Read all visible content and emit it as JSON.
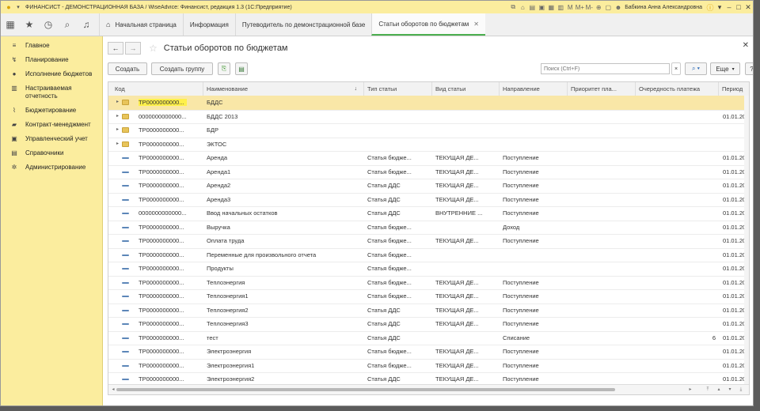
{
  "window": {
    "title": "ФИНАНСИСТ - ДЕМОНСТРАЦИОННАЯ БАЗА / WiseAdvice: Финансист, редакция 1.3  (1С:Предприятие)",
    "user": "Бабкина Анна Александровна",
    "tools": [
      "M",
      "M+",
      "M-"
    ]
  },
  "tabs": [
    {
      "label": "Начальная страница"
    },
    {
      "label": "Информация"
    },
    {
      "label": "Путеводитель по демонстрационной базе"
    },
    {
      "label": "Статьи оборотов по бюджетам"
    }
  ],
  "sidebar": {
    "items": [
      {
        "label": "Главное",
        "icon": "menu-icon"
      },
      {
        "label": "Планирование",
        "icon": "planning-icon"
      },
      {
        "label": "Исполнение бюджетов",
        "icon": "coin-icon"
      },
      {
        "label": "Настраиваемая отчетность",
        "icon": "report-icon"
      },
      {
        "label": "Бюджетирование",
        "icon": "chart-line-icon"
      },
      {
        "label": "Контракт-менеджмент",
        "icon": "contract-icon"
      },
      {
        "label": "Управленческий учет",
        "icon": "ledger-icon"
      },
      {
        "label": "Справочники",
        "icon": "book-icon"
      },
      {
        "label": "Администрирование",
        "icon": "gear-icon"
      }
    ]
  },
  "form": {
    "title": "Статьи оборотов по бюджетам",
    "buttons": {
      "create": "Создать",
      "create_group": "Создать группу",
      "more": "Еще",
      "help": "?"
    },
    "search_placeholder": "Поиск (Ctrl+F)"
  },
  "table": {
    "columns": [
      "Код",
      "Наименование",
      "Тип статьи",
      "Вид статьи",
      "Направление",
      "Приоритет пла...",
      "Очередность платежа",
      "Период"
    ],
    "rows": [
      {
        "kind": "folder",
        "code": "ТР0000000000...",
        "name": "БДДС",
        "type": "",
        "vid": "",
        "dir": "",
        "prio": "",
        "order": "",
        "period": "",
        "selected": true
      },
      {
        "kind": "folder",
        "code": "0000000000000...",
        "name": "БДДС 2013",
        "type": "",
        "vid": "",
        "dir": "",
        "prio": "",
        "order": "",
        "period": "01.01.20"
      },
      {
        "kind": "folder",
        "code": "ТР0000000000...",
        "name": "БДР",
        "type": "",
        "vid": "",
        "dir": "",
        "prio": "",
        "order": "",
        "period": ""
      },
      {
        "kind": "folder",
        "code": "ТР0000000000...",
        "name": "ЭКТОС",
        "type": "",
        "vid": "",
        "dir": "",
        "prio": "",
        "order": "",
        "period": ""
      },
      {
        "kind": "item",
        "code": "ТР0000000000...",
        "name": "Аренда",
        "type": "Статья бюдже...",
        "vid": "ТЕКУЩАЯ ДЕ...",
        "dir": "Поступление",
        "prio": "",
        "order": "",
        "period": "01.01.20"
      },
      {
        "kind": "item",
        "code": "ТР0000000000...",
        "name": "Аренда1",
        "type": "Статья бюдже...",
        "vid": "ТЕКУЩАЯ ДЕ...",
        "dir": "Поступление",
        "prio": "",
        "order": "",
        "period": "01.01.20"
      },
      {
        "kind": "item",
        "code": "ТР0000000000...",
        "name": "Аренда2",
        "type": "Статья ДДС",
        "vid": "ТЕКУЩАЯ ДЕ...",
        "dir": "Поступление",
        "prio": "",
        "order": "",
        "period": "01.01.20"
      },
      {
        "kind": "item",
        "code": "ТР0000000000...",
        "name": "Аренда3",
        "type": "Статья ДДС",
        "vid": "ТЕКУЩАЯ ДЕ...",
        "dir": "Поступление",
        "prio": "",
        "order": "",
        "period": "01.01.20"
      },
      {
        "kind": "item",
        "code": "0000000000000...",
        "name": "Ввод начальных остатков",
        "type": "Статья ДДС",
        "vid": "ВНУТРЕННИЕ ...",
        "dir": "Поступление",
        "prio": "",
        "order": "",
        "period": "01.01.20"
      },
      {
        "kind": "item",
        "code": "ТР0000000000...",
        "name": "Выручка",
        "type": "Статья бюдже...",
        "vid": "",
        "dir": "Доход",
        "prio": "",
        "order": "",
        "period": "01.01.20"
      },
      {
        "kind": "item",
        "code": "ТР0000000000...",
        "name": "Оплата труда",
        "type": "Статья бюдже...",
        "vid": "ТЕКУЩАЯ ДЕ...",
        "dir": "Поступление",
        "prio": "",
        "order": "",
        "period": "01.01.20"
      },
      {
        "kind": "item",
        "code": "ТР0000000000...",
        "name": "Переменные для произвольного отчета",
        "type": "Статья бюдже...",
        "vid": "",
        "dir": "",
        "prio": "",
        "order": "",
        "period": "01.01.20"
      },
      {
        "kind": "item",
        "code": "ТР0000000000...",
        "name": "Продукты",
        "type": "Статья бюдже...",
        "vid": "",
        "dir": "",
        "prio": "",
        "order": "",
        "period": "01.01.20"
      },
      {
        "kind": "item",
        "code": "ТР0000000000...",
        "name": "Теплоэнергия",
        "type": "Статья бюдже...",
        "vid": "ТЕКУЩАЯ ДЕ...",
        "dir": "Поступление",
        "prio": "",
        "order": "",
        "period": "01.01.20"
      },
      {
        "kind": "item",
        "code": "ТР0000000000...",
        "name": "Теплоэнергия1",
        "type": "Статья бюдже...",
        "vid": "ТЕКУЩАЯ ДЕ...",
        "dir": "Поступление",
        "prio": "",
        "order": "",
        "period": "01.01.20"
      },
      {
        "kind": "item",
        "code": "ТР0000000000...",
        "name": "Теплоэнергия2",
        "type": "Статья ДДС",
        "vid": "ТЕКУЩАЯ ДЕ...",
        "dir": "Поступление",
        "prio": "",
        "order": "",
        "period": "01.01.20"
      },
      {
        "kind": "item",
        "code": "ТР0000000000...",
        "name": "Теплоэнергия3",
        "type": "Статья ДДС",
        "vid": "ТЕКУЩАЯ ДЕ...",
        "dir": "Поступление",
        "prio": "",
        "order": "",
        "period": "01.01.20"
      },
      {
        "kind": "item",
        "code": "ТР0000000000...",
        "name": "тест",
        "type": "Статья ДДС",
        "vid": "",
        "dir": "Списание",
        "prio": "",
        "order": "6",
        "period": "01.01.20"
      },
      {
        "kind": "item",
        "code": "ТР0000000000...",
        "name": "Электроэнергия",
        "type": "Статья бюдже...",
        "vid": "ТЕКУЩАЯ ДЕ...",
        "dir": "Поступление",
        "prio": "",
        "order": "",
        "period": "01.01.20"
      },
      {
        "kind": "item",
        "code": "ТР0000000000...",
        "name": "Электроэнергия1",
        "type": "Статья бюдже...",
        "vid": "ТЕКУЩАЯ ДЕ...",
        "dir": "Поступление",
        "prio": "",
        "order": "",
        "period": "01.01.20"
      },
      {
        "kind": "item",
        "code": "ТР0000000000...",
        "name": "Электроэнергия2",
        "type": "Статья ДДС",
        "vid": "ТЕКУЩАЯ ДЕ...",
        "dir": "Поступление",
        "prio": "",
        "order": "",
        "period": "01.01.20"
      }
    ]
  },
  "colors": {
    "accent_yellow": "#fbed9e",
    "selected_row": "#f9e7a7",
    "active_tab": "#4caf50"
  }
}
